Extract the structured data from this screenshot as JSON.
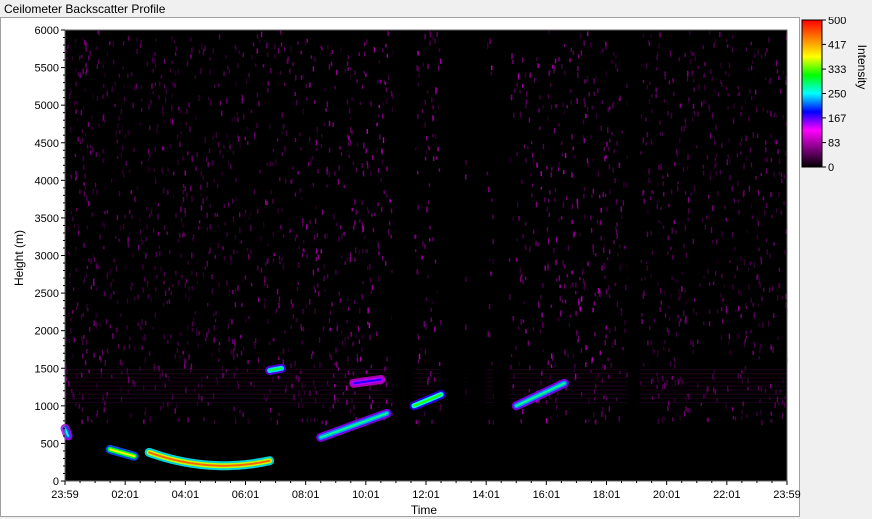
{
  "window": {
    "title": "Ceilometer Backscatter Profile"
  },
  "chart_data": {
    "type": "heatmap",
    "title": "Ceilometer Backscatter Profile",
    "xlabel": "Time",
    "ylabel": "Height (m)",
    "x_tick_labels": [
      "23:59",
      "02:01",
      "04:01",
      "06:01",
      "08:01",
      "10:01",
      "12:01",
      "14:01",
      "16:01",
      "18:01",
      "20:01",
      "22:01",
      "23:59"
    ],
    "y_ticks": [
      0,
      500,
      1000,
      1500,
      2000,
      2500,
      3000,
      3500,
      4000,
      4500,
      5000,
      5500,
      6000
    ],
    "ylim": [
      0,
      6000
    ],
    "xlim_hours": [
      0,
      24
    ],
    "colorbar": {
      "label": "Intensity",
      "ticks": [
        0,
        83,
        167,
        250,
        333,
        417,
        500
      ],
      "range": [
        0,
        500
      ],
      "colors": [
        "#000000",
        "#800080",
        "#ff00ff",
        "#0000ff",
        "#00ffff",
        "#00ff00",
        "#ffff00",
        "#ff8000",
        "#ff0000"
      ]
    },
    "background_noise_intensity": 60,
    "data_gaps_hours": [
      [
        10.9,
        11.6
      ],
      [
        12.5,
        13.3
      ],
      [
        13.35,
        14.0
      ],
      [
        14.25,
        14.75
      ],
      [
        18.7,
        19.1
      ]
    ],
    "cloud_layers": [
      {
        "x_hours": [
          0.0,
          0.1
        ],
        "height_m": [
          700,
          600
        ],
        "intensity": 260
      },
      {
        "x_hours": [
          1.5,
          2.3
        ],
        "height_m": [
          420,
          330
        ],
        "intensity": 380
      },
      {
        "x_hours": [
          2.8,
          6.8
        ],
        "height_m": [
          380,
          210,
          270
        ],
        "intensity": 450
      },
      {
        "x_hours": [
          6.8,
          7.2
        ],
        "height_m": [
          1470,
          1500
        ],
        "intensity": 300
      },
      {
        "x_hours": [
          8.5,
          10.7
        ],
        "height_m": [
          580,
          900
        ],
        "intensity": 280
      },
      {
        "x_hours": [
          9.6,
          10.5
        ],
        "height_m": [
          1300,
          1350
        ],
        "intensity": 180
      },
      {
        "x_hours": [
          11.6,
          12.5
        ],
        "height_m": [
          1000,
          1150
        ],
        "intensity": 320
      },
      {
        "x_hours": [
          15.0,
          16.6
        ],
        "height_m": [
          1000,
          1300
        ],
        "intensity": 280
      }
    ]
  }
}
